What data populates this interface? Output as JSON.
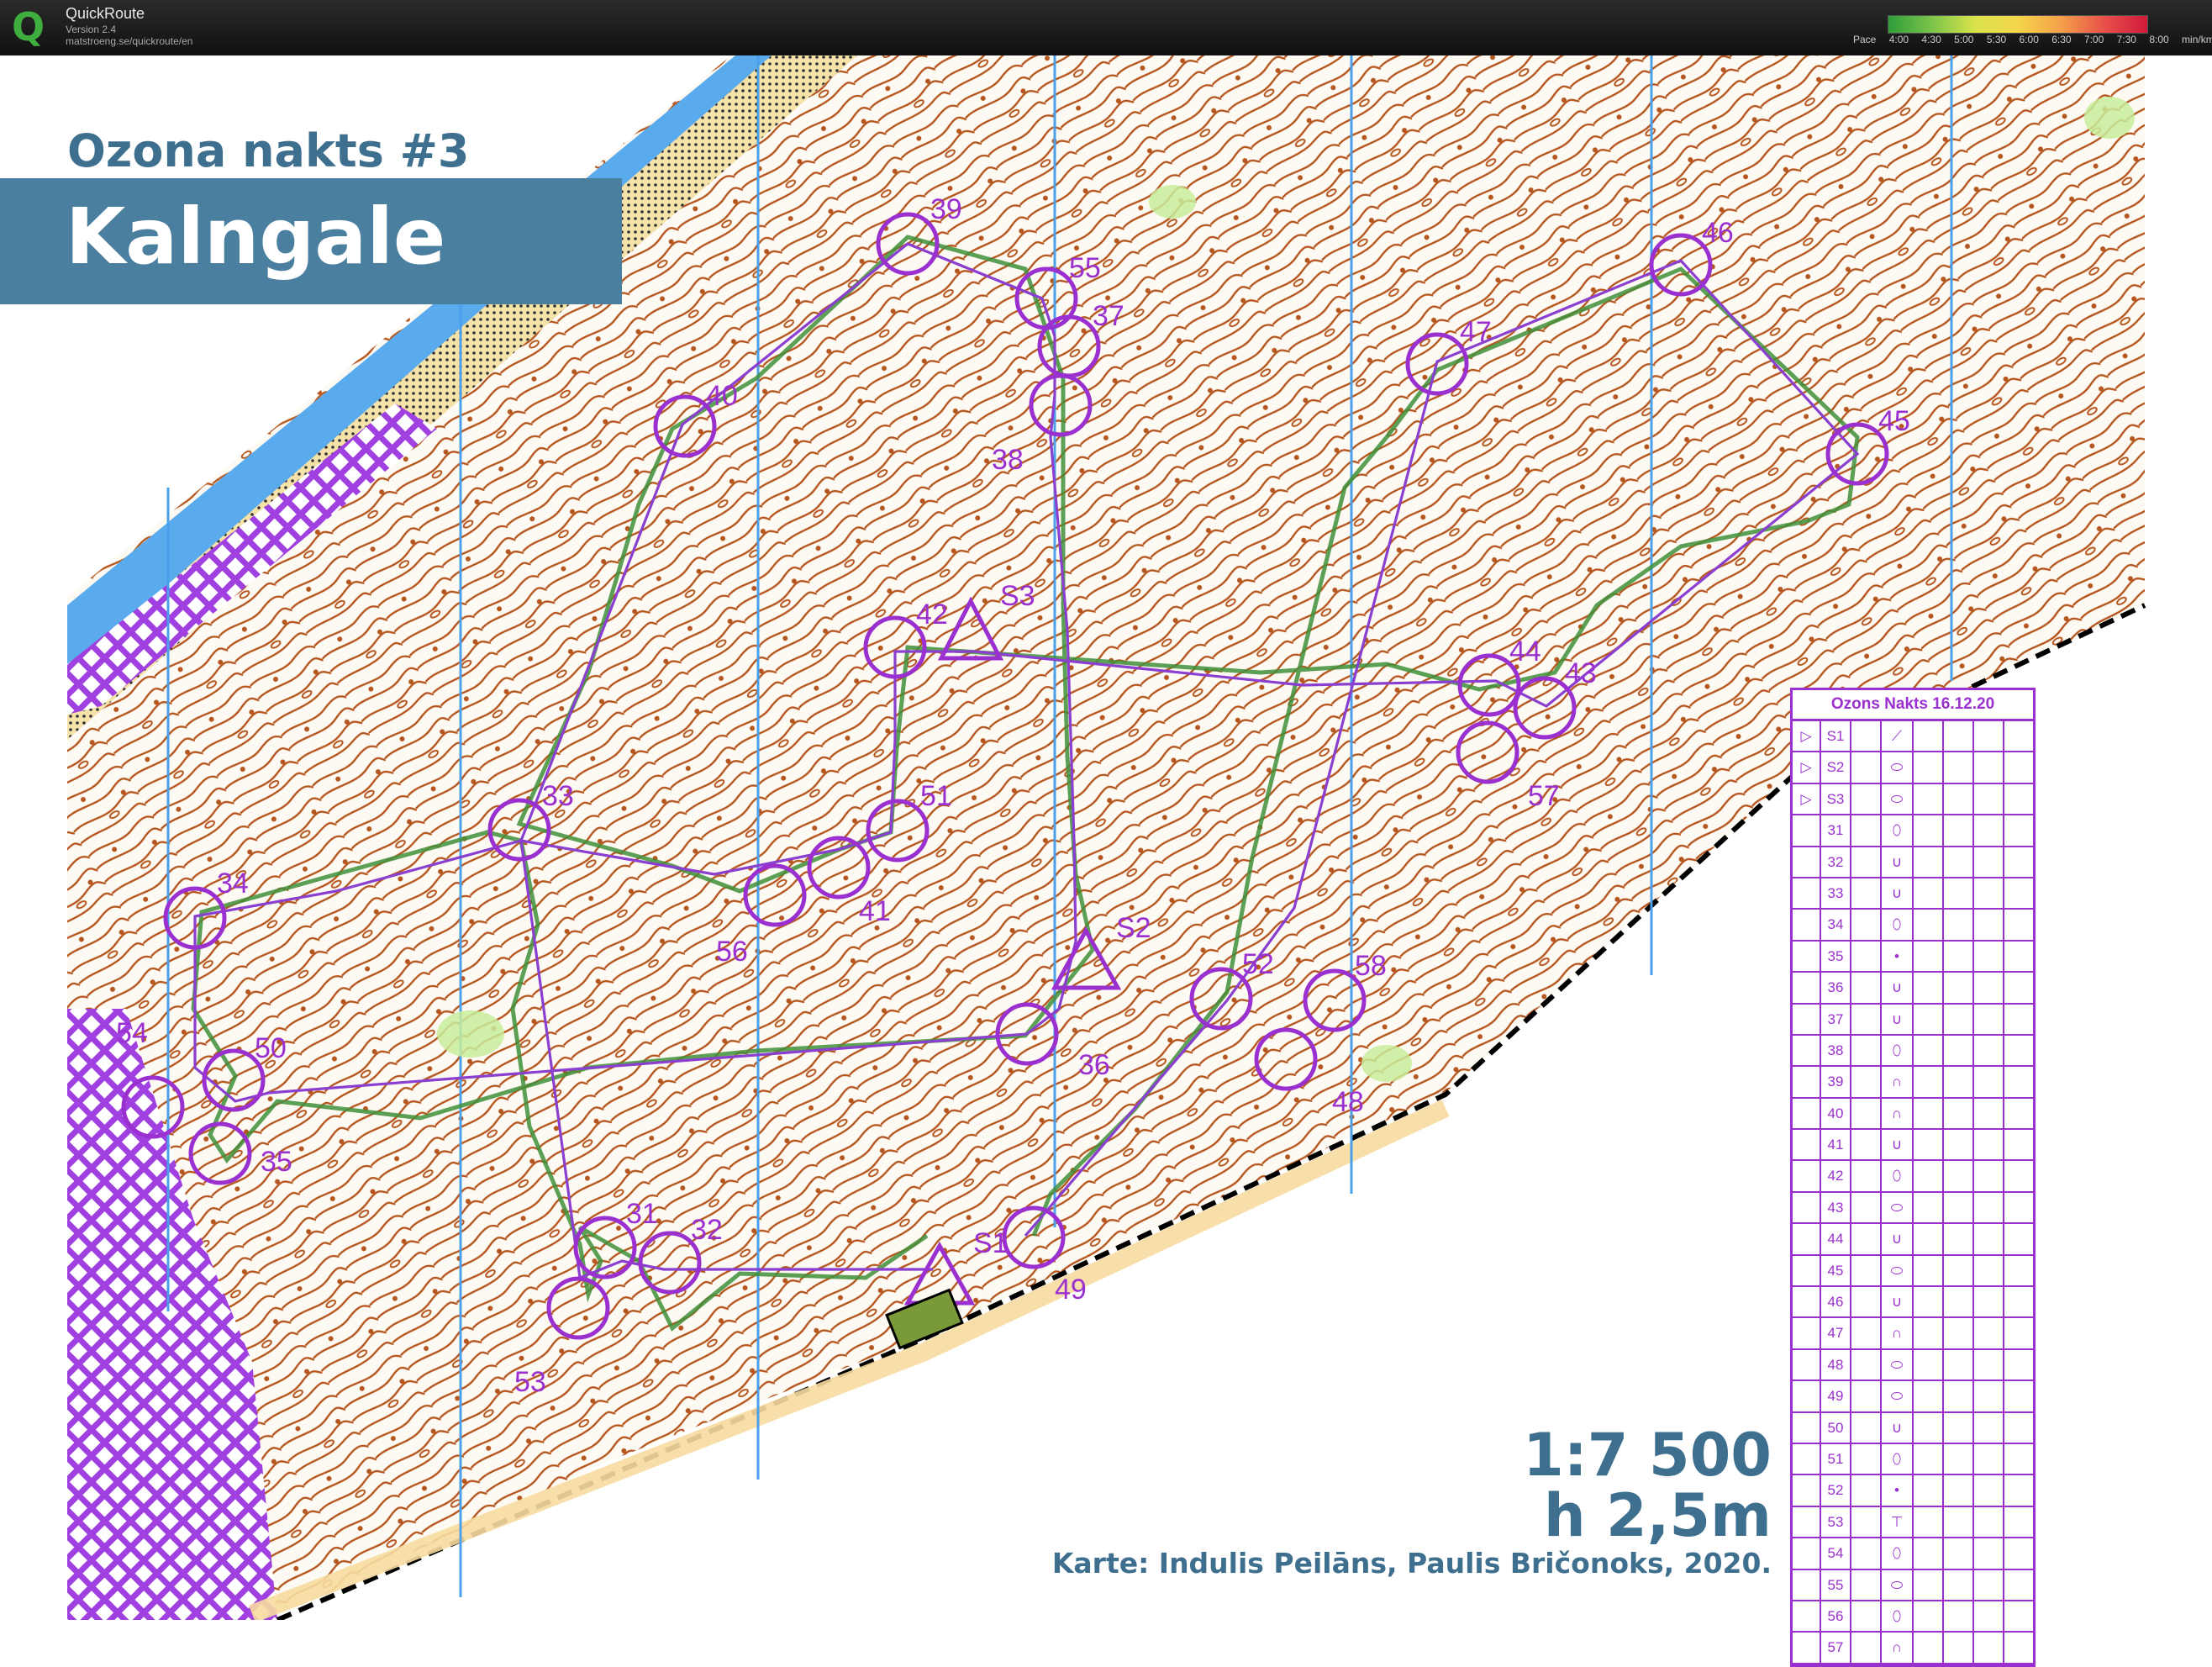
{
  "app": {
    "name": "QuickRoute",
    "version": "Version 2.4",
    "url": "matstroeng.se/quickroute/en"
  },
  "pace_legend": {
    "prefix": "Pace",
    "ticks": [
      "4:00",
      "4:30",
      "5:00",
      "5:30",
      "6:00",
      "6:30",
      "7:00",
      "7:30",
      "8:00"
    ],
    "unit": "min/km"
  },
  "map": {
    "subtitle": "Ozona nakts #3",
    "title": "Kalngale",
    "scale": "1:7 500",
    "equidistance": "h 2,5m",
    "credit": "Karte: Indulis Peilāns, Paulis Bričonoks, 2020.",
    "colors": {
      "contour": "#b5561e",
      "terrain": "#fdfaf3",
      "water": "#5aaaee",
      "course": "#9b30d0",
      "route": "#3f8f3a",
      "sand": "#f7dca0"
    },
    "controls": [
      "39",
      "55",
      "37",
      "40",
      "38",
      "46",
      "47",
      "45",
      "42",
      "44",
      "43",
      "57",
      "33",
      "51",
      "41",
      "56",
      "34",
      "32",
      "52",
      "58",
      "36",
      "48",
      "50",
      "54",
      "35",
      "31",
      "49",
      "53"
    ],
    "starts": [
      "S3",
      "S2",
      "S1"
    ]
  },
  "description_sheet": {
    "title": "Ozons Nakts 16.12.20",
    "rows": [
      {
        "code": "S1",
        "symbol": "⟋"
      },
      {
        "code": "S2",
        "symbol": "⬭"
      },
      {
        "code": "S3",
        "symbol": "⬭"
      },
      {
        "code": "31",
        "symbol": "⬯"
      },
      {
        "code": "32",
        "symbol": "∪"
      },
      {
        "code": "33",
        "symbol": "∪"
      },
      {
        "code": "34",
        "symbol": "⬯"
      },
      {
        "code": "35",
        "symbol": "•"
      },
      {
        "code": "36",
        "symbol": "∪"
      },
      {
        "code": "37",
        "symbol": "∪"
      },
      {
        "code": "38",
        "symbol": "⬯"
      },
      {
        "code": "39",
        "symbol": "∩"
      },
      {
        "code": "40",
        "symbol": "∩"
      },
      {
        "code": "41",
        "symbol": "∪"
      },
      {
        "code": "42",
        "symbol": "⬯"
      },
      {
        "code": "43",
        "symbol": "⬭"
      },
      {
        "code": "44",
        "symbol": "∪"
      },
      {
        "code": "45",
        "symbol": "⬭"
      },
      {
        "code": "46",
        "symbol": "∪"
      },
      {
        "code": "47",
        "symbol": "∩"
      },
      {
        "code": "48",
        "symbol": "⬭"
      },
      {
        "code": "49",
        "symbol": "⬭"
      },
      {
        "code": "50",
        "symbol": "∪"
      },
      {
        "code": "51",
        "symbol": "⬯"
      },
      {
        "code": "52",
        "symbol": "•"
      },
      {
        "code": "53",
        "symbol": "⊤"
      },
      {
        "code": "54",
        "symbol": "⬯"
      },
      {
        "code": "55",
        "symbol": "⬭"
      },
      {
        "code": "56",
        "symbol": "⬯"
      },
      {
        "code": "57",
        "symbol": "∩"
      }
    ]
  }
}
